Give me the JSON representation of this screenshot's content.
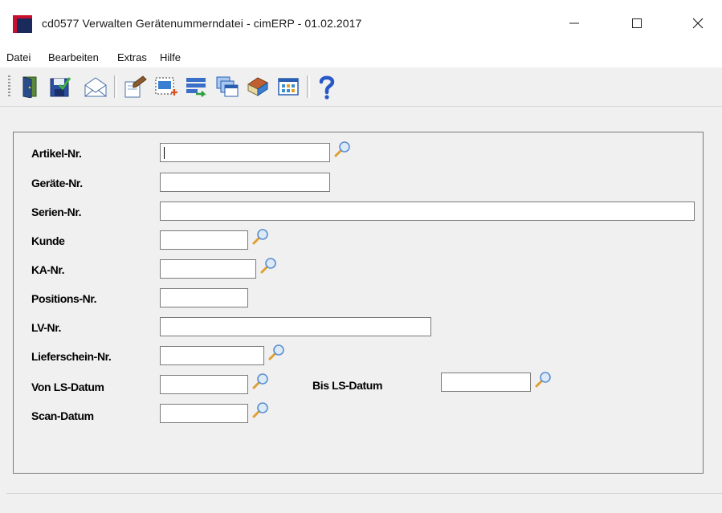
{
  "window": {
    "title": "cd0577 Verwalten Gerätenummerndatei - cimERP - 01.02.2017",
    "controls": [
      "minimize-icon",
      "maximize-icon",
      "close-icon"
    ]
  },
  "menu": {
    "items": [
      {
        "label": "Datei"
      },
      {
        "label": "Bearbeiten"
      },
      {
        "label": "Extras"
      },
      {
        "label": "Hilfe"
      }
    ]
  },
  "toolbar": {
    "buttons": [
      "exit-door-icon",
      "save-icon",
      "mail-icon",
      "edit-record-icon",
      "new-record-icon",
      "transfer-list-icon",
      "windows-icon",
      "book-icon",
      "grid-icon",
      "help-icon"
    ]
  },
  "form": {
    "fields": [
      {
        "label": "Artikel-Nr.",
        "value": "",
        "lookup": true
      },
      {
        "label": "Geräte-Nr.",
        "value": "",
        "lookup": false
      },
      {
        "label": "Serien-Nr.",
        "value": "",
        "lookup": false
      },
      {
        "label": "Kunde",
        "value": "",
        "lookup": true
      },
      {
        "label": "KA-Nr.",
        "value": "",
        "lookup": true
      },
      {
        "label": "Positions-Nr.",
        "value": "",
        "lookup": false
      },
      {
        "label": "LV-Nr.",
        "value": "",
        "lookup": false
      },
      {
        "label": "Lieferschein-Nr.",
        "value": "",
        "lookup": true
      },
      {
        "label": "Von LS-Datum",
        "value": "",
        "lookup": true
      },
      {
        "label": "Scan-Datum",
        "value": "",
        "lookup": true
      }
    ],
    "bis_ls_datum": {
      "label": "Bis LS-Datum",
      "value": "",
      "lookup": true
    }
  },
  "colors": {
    "icon_red": "#c8102e",
    "icon_navy": "#1b2a5c",
    "field_border": "#7a7a7a",
    "magnifier_handle": "#e0a030",
    "magnifier_lens": "#5b8fd0"
  }
}
